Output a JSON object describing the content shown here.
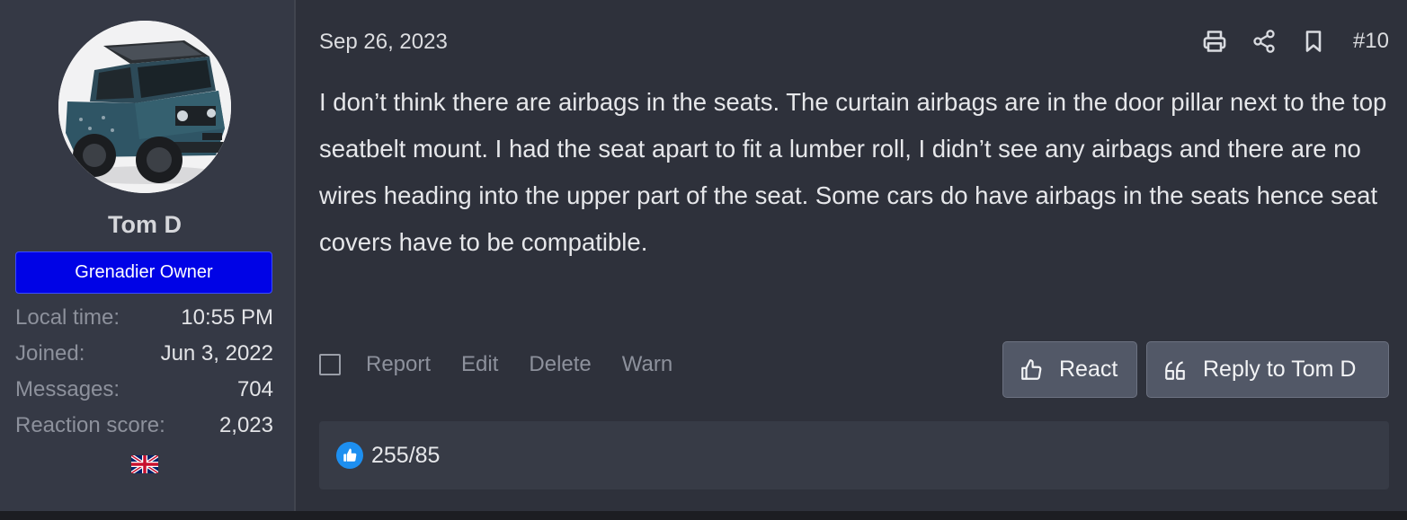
{
  "user": {
    "name": "Tom D",
    "badge": "Grenadier Owner",
    "stats": [
      {
        "label": "Local time:",
        "value": "10:55 PM"
      },
      {
        "label": "Joined:",
        "value": "Jun 3, 2022"
      },
      {
        "label": "Messages:",
        "value": "704"
      },
      {
        "label": "Reaction score:",
        "value": "2,023"
      }
    ],
    "flag_icon": "uk-flag-icon",
    "badge_color": "#0003e6"
  },
  "post": {
    "date": "Sep 26, 2023",
    "number": "#10",
    "body": "I don’t think there are airbags in the seats. The curtain airbags are in the door pillar next to the top seatbelt mount. I had the seat apart to fit a lumber roll, I didn’t see any airbags and there are no wires heading into the upper part of the seat. Some cars do have airbags in the seats hence seat covers have to be compatible.",
    "top_icons": [
      "print-icon",
      "share-icon",
      "bookmark-icon"
    ],
    "actions": {
      "report": "Report",
      "edit": "Edit",
      "delete": "Delete",
      "warn": "Warn"
    },
    "react_label": "React",
    "reply_label": "Reply to Tom D",
    "reactions_summary": "255/85"
  },
  "colors": {
    "background": "#2e313b",
    "sidebar": "#353945",
    "like_blue": "#1d8ff0"
  }
}
